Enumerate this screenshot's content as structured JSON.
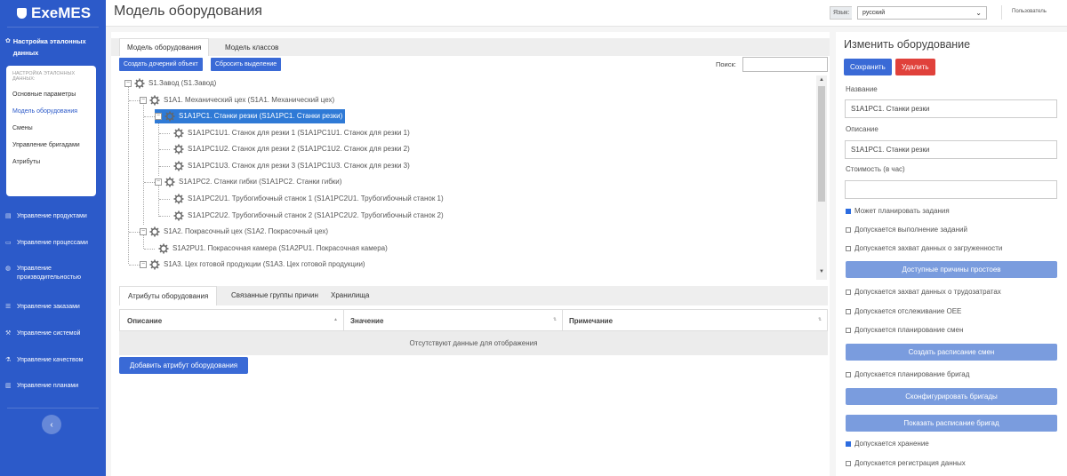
{
  "brand": "ExeMES",
  "sidebar": {
    "active_section": "Настройка эталонных данных",
    "submenu_header": "НАСТРОЙКА ЭТАЛОННЫХ ДАННЫХ:",
    "submenu": [
      "Основные параметры",
      "Модель оборудования",
      "Смены",
      "Управление бригадами",
      "Атрибуты"
    ],
    "menu": [
      "Управление продуктами",
      "Управление процессами",
      "Управление производительностью",
      "Управление заказами",
      "Управление системой",
      "Управление качеством",
      "Управление планами"
    ]
  },
  "topbar": {
    "title": "Модель оборудования",
    "lang_label": "Язык:",
    "lang_value": "русский",
    "user": "Пользователь"
  },
  "main": {
    "tabs": [
      "Модель оборудования",
      "Модель классов"
    ],
    "btn_create_child": "Создать дочерний объект",
    "btn_reset_selection": "Сбросить выделение",
    "search_label": "Поиск:",
    "tree": [
      "S1.Завод (S1.Завод)",
      "S1A1. Механический цех (S1A1. Механический цех)",
      "S1A1PC1. Станки резки (S1A1PC1. Станки резки)",
      "S1A1PC1U1. Станок для резки 1 (S1A1PC1U1. Станок для резки 1)",
      "S1A1PC1U2. Станок для резки 2 (S1A1PC1U2. Станок для резки 2)",
      "S1A1PC1U3. Станок для резки 3 (S1A1PC1U3. Станок для резки 3)",
      "S1A1PC2. Станки гибки (S1A1PC2. Станки гибки)",
      "S1A1PC2U1. Трубогибочный станок 1 (S1A1PC2U1. Трубогибочный станок 1)",
      "S1A1PC2U2. Трубогибочный станок 2 (S1A1PC2U2. Трубогибочный станок 2)",
      "S1A2. Покрасочный цех (S1A2. Покрасочный цех)",
      "S1A2PU1. Покрасочная камера (S1A2PU1. Покрасочная камера)",
      "S1A3. Цех готовой продукции (S1A3. Цех готовой продукции)"
    ],
    "bottom_tabs": [
      "Атрибуты оборудования",
      "Связанные группы причин",
      "Хранилища"
    ],
    "grid_headers": [
      "Описание",
      "Значение",
      "Примечание"
    ],
    "grid_empty": "Отсутствуют данные для отображения",
    "btn_add_attribute": "Добавить атрибут оборудования"
  },
  "right": {
    "title": "Изменить оборудование",
    "save": "Сохранить",
    "delete": "Удалить",
    "name_label": "Название",
    "name_value": "S1A1PC1. Станки резки",
    "desc_label": "Описание",
    "desc_value": "S1A1PC1. Станки резки",
    "cost_label": "Стоимость (в час)",
    "cost_value": "",
    "chk_plan_tasks": "Может планировать задания",
    "chk_exec_tasks": "Допускается выполнение заданий",
    "chk_load_capture": "Допускается захват данных о загруженности",
    "btn_downtime": "Доступные причины простоев",
    "chk_labor_capture": "Допускается захват данных о трудозатратах",
    "chk_oee": "Допускается отслеживание OEE",
    "chk_shift_plan": "Допускается планирование смен",
    "btn_shift_schedule": "Создать расписание смен",
    "chk_crew_plan": "Допускается планирование бригад",
    "btn_config_crews": "Сконфигурировать бригады",
    "btn_show_crew_schedule": "Показать расписание бригад",
    "chk_storage": "Допускается хранение",
    "chk_data_reg": "Допускается регистрация данных"
  },
  "colors": {
    "sidebar": "#2c5ac9",
    "primary": "#3a6ad6",
    "danger": "#e0413b",
    "selected": "#2f7ad6"
  }
}
